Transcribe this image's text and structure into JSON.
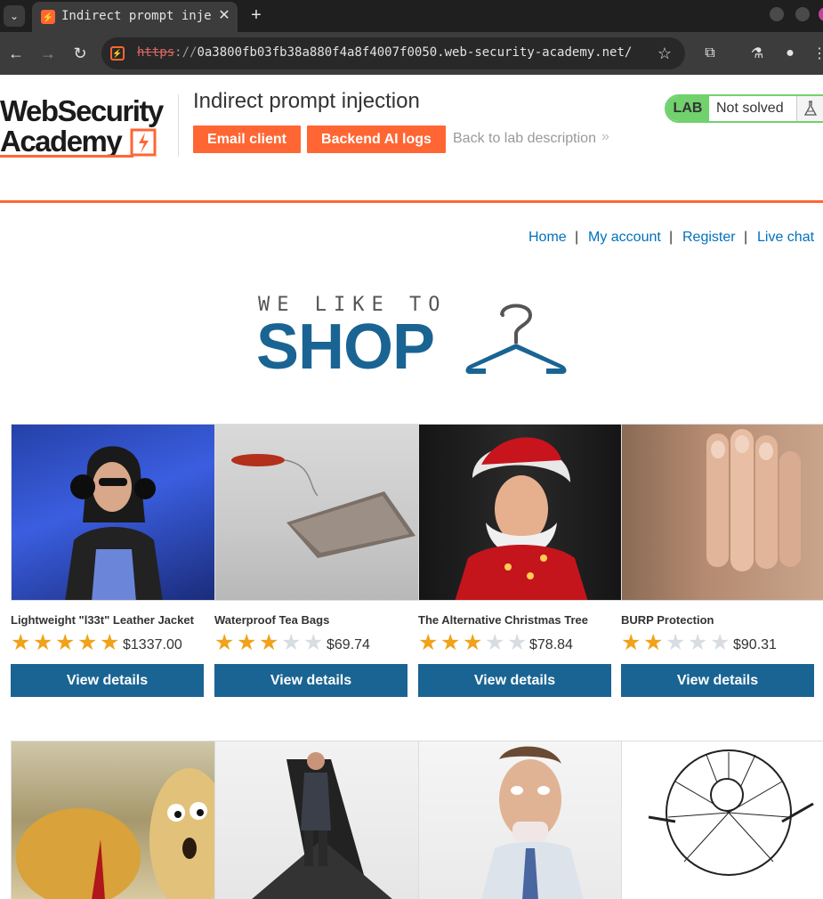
{
  "browser": {
    "tab_title": "Indirect prompt injection",
    "url_scheme": "https",
    "url_sep": "://",
    "url_rest": "0a3800fb03fb38a880f4a8f4007f0050.web-security-academy.net/"
  },
  "lab": {
    "logo_line1": "WebSecurity",
    "logo_line2": "Academy",
    "title": "Indirect prompt injection",
    "buttons": [
      "Email client",
      "Backend AI logs"
    ],
    "back_link": "Back to lab description",
    "status_badge": "LAB",
    "status_text": "Not solved",
    "accent_color": "#ff6633",
    "status_color": "#70d16d"
  },
  "nav": {
    "links": [
      "Home",
      "My account",
      "Register",
      "Live chat"
    ],
    "separator": "|"
  },
  "banner": {
    "line1": "WE LIKE TO",
    "line2": "SHOP"
  },
  "products": [
    {
      "name": "Lightweight \"l33t\" Leather Jacket",
      "rating": 5,
      "price": "$1337.00",
      "button": "View details"
    },
    {
      "name": "Waterproof Tea Bags",
      "rating": 3,
      "price": "$69.74",
      "button": "View details"
    },
    {
      "name": "The Alternative Christmas Tree",
      "rating": 3,
      "price": "$78.84",
      "button": "View details"
    },
    {
      "name": "BURP Protection",
      "rating": 2,
      "price": "$90.31",
      "button": "View details"
    }
  ],
  "brand_color": "#1a6493"
}
